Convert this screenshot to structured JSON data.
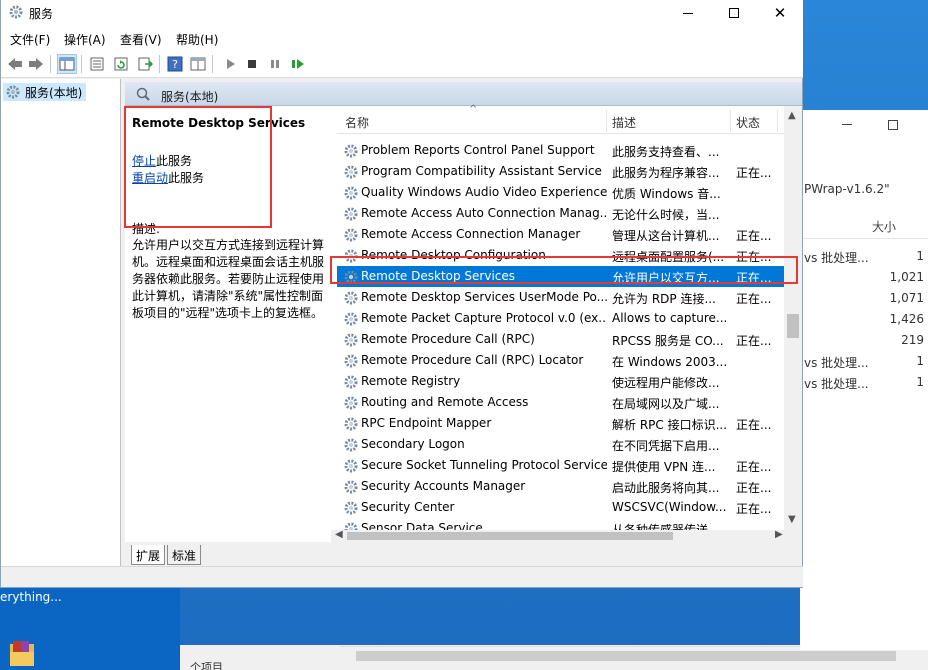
{
  "window": {
    "title": "服务",
    "minimize": "—",
    "maximize": "☐",
    "close": "✕"
  },
  "menu": [
    "文件(F)",
    "操作(A)",
    "查看(V)",
    "帮助(H)"
  ],
  "tree": {
    "root_label": "服务(本地)"
  },
  "right_header": {
    "title": "服务(本地)"
  },
  "details": {
    "service_name": "Remote Desktop Services",
    "stop_link": "停止",
    "stop_suffix": "此服务",
    "restart_link": "重启动",
    "restart_suffix": "此服务",
    "desc_label": "描述:",
    "description": "允许用户以交互方式连接到远程计算机。远程桌面和远程桌面会话主机服务器依赖此服务。若要防止远程使用此计算机，请清除\"系统\"属性控制面板项目的\"远程\"选项卡上的复选框。"
  },
  "list": {
    "columns": {
      "name": "名称",
      "description": "描述",
      "status": "状态"
    },
    "rows": [
      {
        "name": "Problem Reports Control Panel Support",
        "desc": "此服务支持查看、...",
        "status": ""
      },
      {
        "name": "Program Compatibility Assistant Service",
        "desc": "此服务为程序兼容...",
        "status": "正在..."
      },
      {
        "name": "Quality Windows Audio Video Experience",
        "desc": "优质 Windows 音...",
        "status": ""
      },
      {
        "name": "Remote Access Auto Connection Manag...",
        "desc": "无论什么时候，当...",
        "status": ""
      },
      {
        "name": "Remote Access Connection Manager",
        "desc": "管理从这台计算机...",
        "status": "正在..."
      },
      {
        "name": "Remote Desktop Configuration",
        "desc": "远程桌面配置服务(...",
        "status": "正在..."
      },
      {
        "name": "Remote Desktop Services",
        "desc": "允许用户以交互方...",
        "status": "正在...",
        "selected": true
      },
      {
        "name": "Remote Desktop Services UserMode Po...",
        "desc": "允许为 RDP 连接...",
        "status": "正在..."
      },
      {
        "name": "Remote Packet Capture Protocol v.0 (ex...",
        "desc": "Allows to capture...",
        "status": ""
      },
      {
        "name": "Remote Procedure Call (RPC)",
        "desc": "RPCSS 服务是 CO...",
        "status": "正在..."
      },
      {
        "name": "Remote Procedure Call (RPC) Locator",
        "desc": "在 Windows 2003...",
        "status": ""
      },
      {
        "name": "Remote Registry",
        "desc": "使远程用户能修改...",
        "status": ""
      },
      {
        "name": "Routing and Remote Access",
        "desc": "在局域网以及广域...",
        "status": ""
      },
      {
        "name": "RPC Endpoint Mapper",
        "desc": "解析 RPC 接口标识...",
        "status": "正在..."
      },
      {
        "name": "Secondary Logon",
        "desc": "在不同凭据下启用...",
        "status": ""
      },
      {
        "name": "Secure Socket Tunneling Protocol Service",
        "desc": "提供使用 VPN 连...",
        "status": "正在..."
      },
      {
        "name": "Security Accounts Manager",
        "desc": "启动此服务将向其...",
        "status": "正在..."
      },
      {
        "name": "Security Center",
        "desc": "WSCSVC(Window...",
        "status": "正在..."
      },
      {
        "name": "Sensor Data Service",
        "desc": "从各种传感器传送...",
        "status": ""
      }
    ]
  },
  "tabs": [
    "扩展",
    "标准"
  ],
  "background_window": {
    "title_fragment": "PWrap-v1.6.2\"",
    "col_size": "大小",
    "rows": [
      {
        "label": "vs 批处理...",
        "size": "1"
      },
      {
        "label": "",
        "size": "1,021"
      },
      {
        "label": "",
        "size": "1,071"
      },
      {
        "label": "",
        "size": "1,426"
      },
      {
        "label": "",
        "size": "219"
      },
      {
        "label": "vs 批处理...",
        "size": "1"
      },
      {
        "label": "vs 批处理...",
        "size": "1"
      }
    ]
  },
  "desktop": {
    "everything_text": "erything...",
    "bottom_text": "个项目"
  }
}
